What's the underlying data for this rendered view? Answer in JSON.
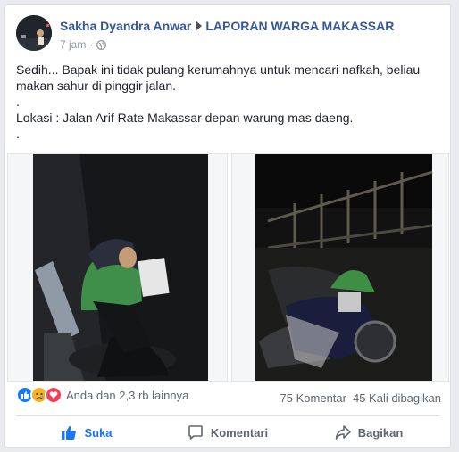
{
  "post": {
    "author": "Sakha Dyandra Anwar",
    "group": "LAPORAN WARGA MAKASSAR",
    "time": "7 jam",
    "lines": [
      "Sedih... Bapak ini tidak pulang kerumahnya untuk mencari nafkah, beliau makan sahur di pinggir jalan.",
      ".",
      "Lokasi : Jalan Arif Rate Makassar depan warung mas daeng.",
      "."
    ]
  },
  "reactions": {
    "icons": [
      "like-icon",
      "sad-icon",
      "love-icon"
    ],
    "summary": "Anda dan 2,3 rb lainnya",
    "comments": "75 Komentar",
    "shares": "45 Kali dibagikan"
  },
  "actions": {
    "like": "Suka",
    "comment": "Komentari",
    "share": "Bagikan"
  },
  "colors": {
    "link": "#365899",
    "like": "#1877f2",
    "love": "#f33e58",
    "sad": "#f7b125"
  }
}
